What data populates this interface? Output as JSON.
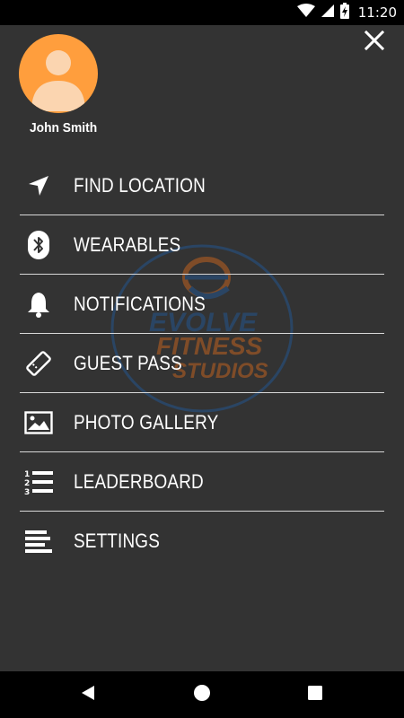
{
  "status_bar": {
    "time": "11:20",
    "icons": [
      "wifi-icon",
      "cell-signal-icon",
      "battery-charging-icon"
    ]
  },
  "drawer": {
    "close_icon": "close-icon",
    "user": {
      "name": "John Smith",
      "avatar_icon": "default-avatar-icon",
      "avatar_color": "#FF9E3D"
    },
    "watermark": {
      "line1": "EVOLVE",
      "line2": "FITNESS",
      "line3": "STUDIOS"
    },
    "menu": [
      {
        "label": "FIND LOCATION",
        "icon": "navigation-arrow-icon"
      },
      {
        "label": "WEARABLES",
        "icon": "bluetooth-icon"
      },
      {
        "label": "NOTIFICATIONS",
        "icon": "bell-icon"
      },
      {
        "label": "GUEST PASS",
        "icon": "ticket-icon"
      },
      {
        "label": "PHOTO GALLERY",
        "icon": "image-icon"
      },
      {
        "label": "LEADERBOARD",
        "icon": "numbered-list-icon"
      },
      {
        "label": "SETTINGS",
        "icon": "menu-lines-icon"
      }
    ]
  },
  "nav_bar": {
    "buttons": [
      "back-icon",
      "home-icon",
      "recents-icon"
    ]
  },
  "colors": {
    "background": "#333333",
    "divider": "#d8d8d8",
    "text": "#ffffff",
    "accent": "#FF9E3D",
    "watermark_blue": "#1E5FA8",
    "watermark_orange": "#E8701A"
  }
}
